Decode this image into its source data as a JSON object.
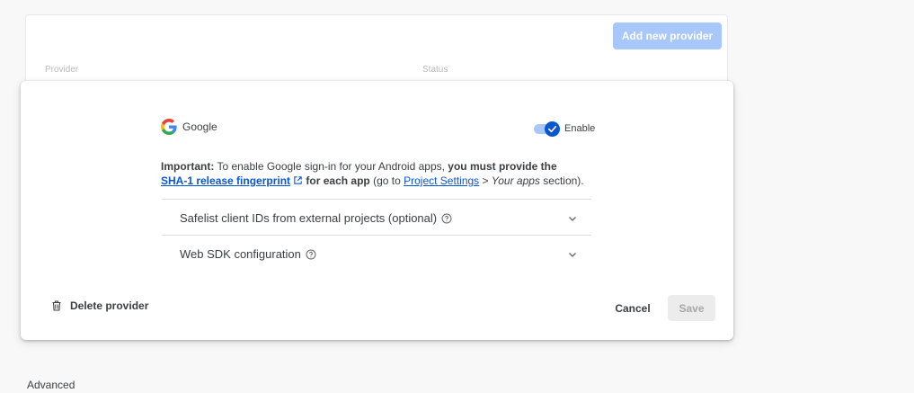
{
  "background_card": {
    "add_button_label": "Add new provider",
    "columns": [
      "Provider",
      "Status"
    ]
  },
  "modal": {
    "provider_name": "Google",
    "provider_icon": "google-g-icon",
    "toggle": {
      "label": "Enable",
      "enabled": true
    },
    "note": {
      "important_prefix": "Important:",
      "text_1": "To enable Google sign-in for your Android apps,",
      "bold_1": "you must provide the",
      "link_1": "SHA-1 release fingerprint",
      "bold_2": "for each app",
      "text_2": "(go to",
      "link_2": "Project Settings",
      "text_3": ">",
      "italic_1": "Your apps",
      "text_4": "section)."
    },
    "accordions": [
      {
        "label": "Safelist client IDs from external projects (optional)"
      },
      {
        "label": "Web SDK configuration"
      }
    ],
    "delete_label": "Delete provider",
    "cancel_label": "Cancel",
    "save_label": "Save"
  },
  "advanced_label": "Advanced",
  "colors": {
    "primary": "#0b57d0",
    "primary_light": "#a8c7fa",
    "text": "#3c4043",
    "disabled_bg": "#ececec",
    "disabled_text": "#a7a7a7"
  }
}
